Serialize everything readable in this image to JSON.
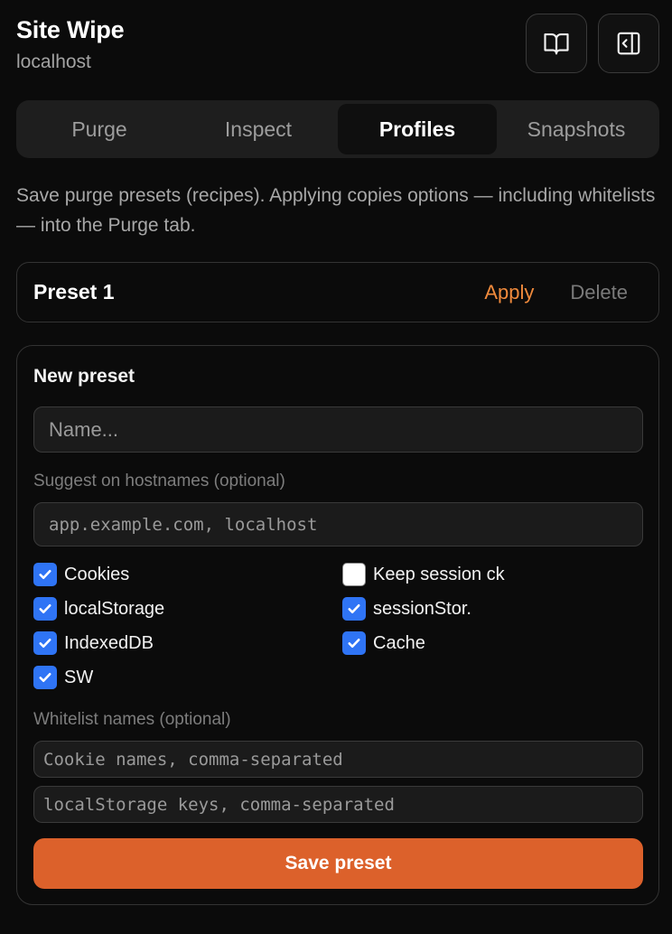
{
  "header": {
    "title": "Site Wipe",
    "subtitle": "localhost"
  },
  "icons": {
    "docs": "book-open-icon",
    "sidebar": "panel-collapse-icon"
  },
  "tabs": [
    {
      "label": "Purge",
      "active": false
    },
    {
      "label": "Inspect",
      "active": false
    },
    {
      "label": "Profiles",
      "active": true
    },
    {
      "label": "Snapshots",
      "active": false
    }
  ],
  "description": "Save purge presets (recipes). Applying copies options — including whitelists — into the Purge tab.",
  "presets": [
    {
      "name": "Preset 1",
      "apply_label": "Apply",
      "delete_label": "Delete"
    }
  ],
  "new_preset": {
    "title": "New preset",
    "name_placeholder": "Name...",
    "hostnames_label": "Suggest on hostnames (optional)",
    "hostnames_placeholder": "app.example.com, localhost",
    "options": [
      {
        "label": "Cookies",
        "checked": true
      },
      {
        "label": "Keep session ck",
        "checked": false
      },
      {
        "label": "localStorage",
        "checked": true
      },
      {
        "label": "sessionStor.",
        "checked": true
      },
      {
        "label": "IndexedDB",
        "checked": true
      },
      {
        "label": "Cache",
        "checked": true
      },
      {
        "label": "SW",
        "checked": true
      }
    ],
    "whitelist_label": "Whitelist names (optional)",
    "cookie_placeholder": "Cookie names, comma-separated",
    "storage_placeholder": "localStorage keys, comma-separated",
    "save_label": "Save preset"
  },
  "colors": {
    "accent": "#dc612b",
    "apply_link": "#f08a3c",
    "checkbox_on": "#2f74f5",
    "background": "#0b0b0b"
  }
}
